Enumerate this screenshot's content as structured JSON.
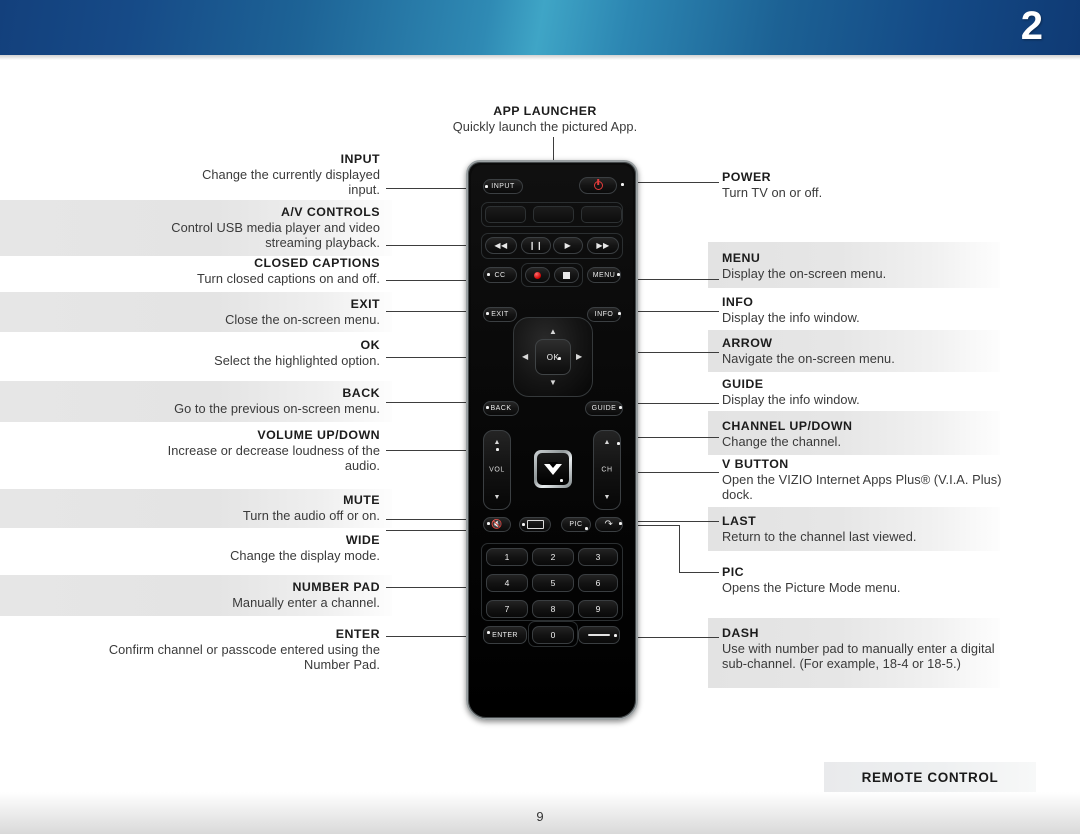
{
  "header": {
    "chapter_number": "2"
  },
  "footer": {
    "section_label": "REMOTE CONTROL",
    "page_number": "9"
  },
  "top_callout": {
    "title": "APP LAUNCHER",
    "description": "Quickly launch the pictured App."
  },
  "left_callouts": [
    {
      "title": "INPUT",
      "description": "Change the currently displayed input."
    },
    {
      "title": "A/V CONTROLS",
      "description": "Control USB media player and video streaming playback."
    },
    {
      "title": "CLOSED CAPTIONS",
      "description": "Turn closed captions on and off."
    },
    {
      "title": "EXIT",
      "description": "Close the on-screen menu."
    },
    {
      "title": "OK",
      "description": "Select the highlighted option."
    },
    {
      "title": "BACK",
      "description": "Go to the previous on-screen menu."
    },
    {
      "title": "VOLUME UP/DOWN",
      "description": "Increase or decrease loudness of the audio."
    },
    {
      "title": "MUTE",
      "description": "Turn the audio off or on."
    },
    {
      "title": "WIDE",
      "description": "Change the display mode."
    },
    {
      "title": "NUMBER PAD",
      "description": "Manually enter a channel."
    },
    {
      "title": "ENTER",
      "description": "Confirm channel or passcode entered using the Number Pad."
    }
  ],
  "right_callouts": [
    {
      "title": "POWER",
      "description": "Turn TV on or off."
    },
    {
      "title": "MENU",
      "description": "Display the on-screen menu."
    },
    {
      "title": "INFO",
      "description": "Display the info window."
    },
    {
      "title": "ARROW",
      "description": "Navigate the on-screen menu."
    },
    {
      "title": "GUIDE",
      "description": "Display the info window."
    },
    {
      "title": "CHANNEL UP/DOWN",
      "description": "Change the channel."
    },
    {
      "title": "V BUTTON",
      "description": "Open the VIZIO Internet Apps Plus® (V.I.A. Plus) dock."
    },
    {
      "title": "LAST",
      "description": "Return to the channel last viewed."
    },
    {
      "title": "PIC",
      "description": "Opens the Picture Mode menu."
    },
    {
      "title": "DASH",
      "description": "Use with number pad to manually enter a digital sub-channel. (For example, 18-4 or 18-5.)"
    }
  ],
  "remote": {
    "input_label": "INPUT",
    "cc_label": "CC",
    "menu_label": "MENU",
    "exit_label": "EXIT",
    "info_label": "INFO",
    "back_label": "BACK",
    "guide_label": "GUIDE",
    "ok_label": "OK",
    "vol_label": "VOL",
    "ch_label": "CH",
    "pic_label": "PIC",
    "enter_label": "ENTER",
    "numbers": [
      "1",
      "2",
      "3",
      "4",
      "5",
      "6",
      "7",
      "8",
      "9"
    ],
    "zero_label": "0",
    "arrow_up": "▲",
    "arrow_down": "▼",
    "arrow_left": "◀",
    "arrow_right": "▶",
    "rewind": "◀◀",
    "pause": "❙❙",
    "play": "▶",
    "forward": "▶▶"
  },
  "colors": {
    "header_dark": "#13407c",
    "header_light": "#3fa5c6",
    "band_gray": "#e5e5e5",
    "text_dark": "#1c1c1c",
    "remote_black": "#000000",
    "remote_chrome": "#9aa0a2",
    "power_red": "#e23b3b"
  }
}
